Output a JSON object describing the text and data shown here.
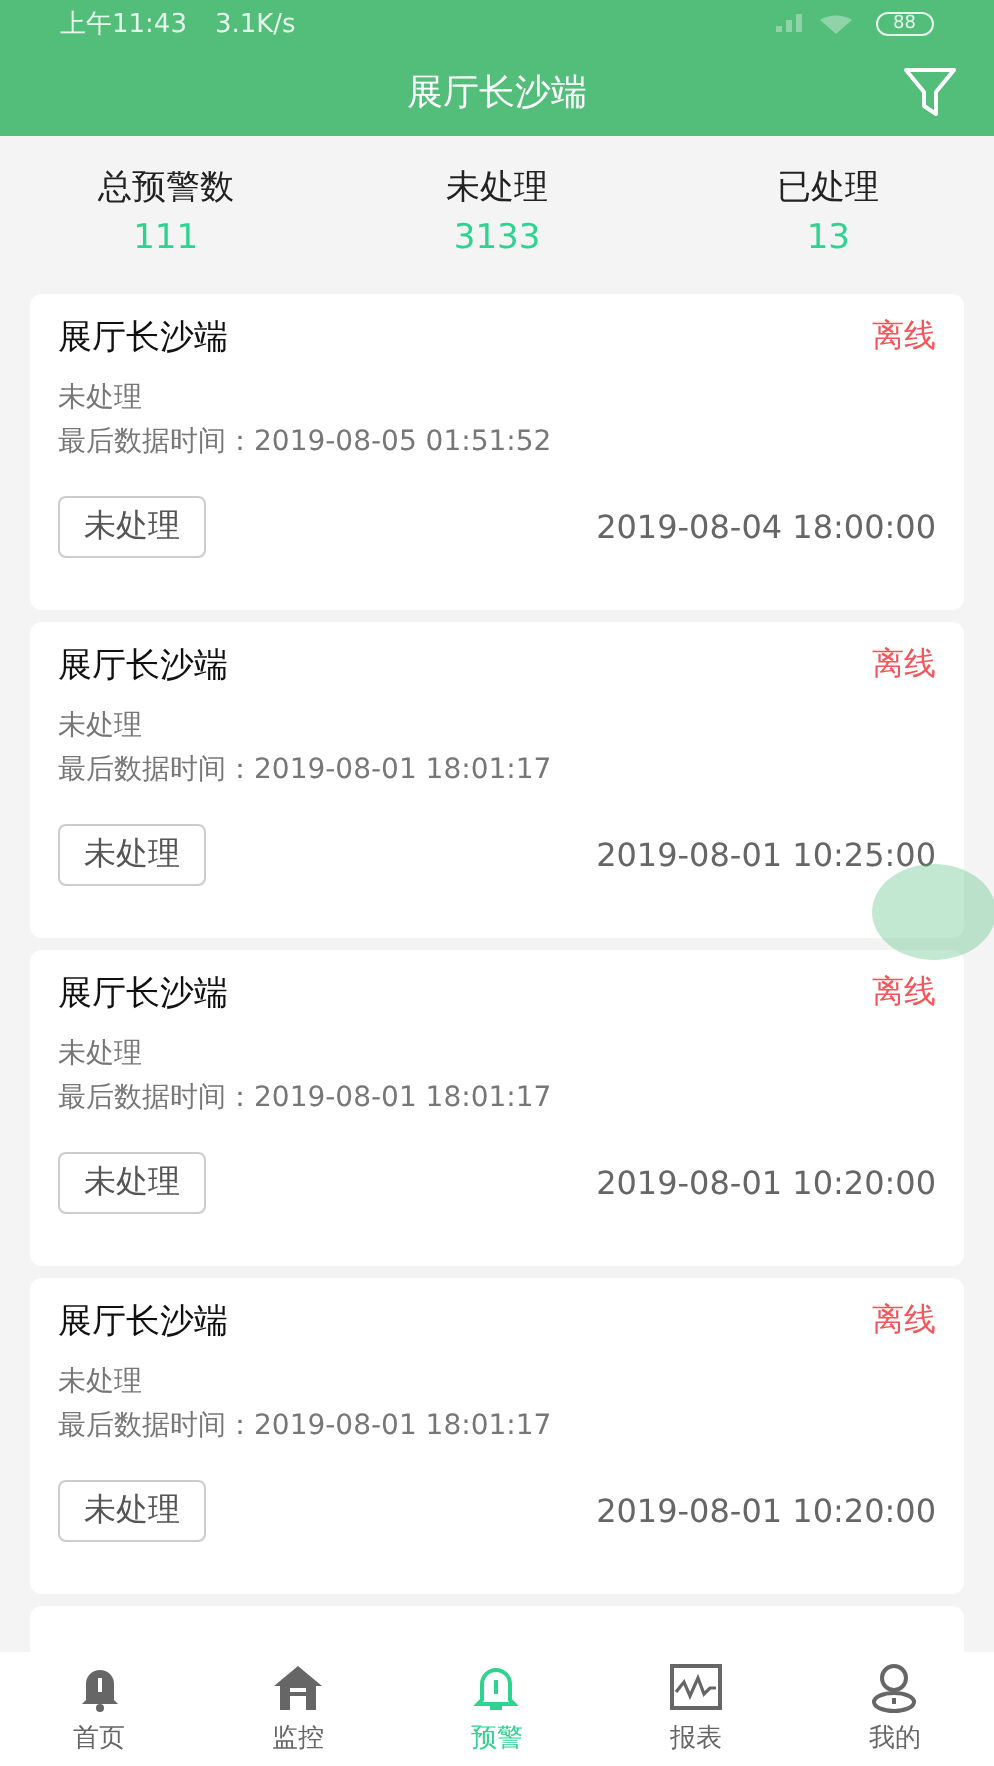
{
  "status_bar": {
    "time": "上午11:43",
    "speed": "3.1K/s",
    "battery": "88"
  },
  "header": {
    "title": "展厅长沙端"
  },
  "stats": [
    {
      "label": "总预警数",
      "value": "111"
    },
    {
      "label": "未处理",
      "value": "3133"
    },
    {
      "label": "已处理",
      "value": "13"
    }
  ],
  "alerts": [
    {
      "name": "展厅长沙端",
      "status": "离线",
      "state": "未处理",
      "last_data": "最后数据时间：2019-08-05 01:51:52",
      "button": "未处理",
      "time": "2019-08-04 18:00:00"
    },
    {
      "name": "展厅长沙端",
      "status": "离线",
      "state": "未处理",
      "last_data": "最后数据时间：2019-08-01 18:01:17",
      "button": "未处理",
      "time": "2019-08-01 10:25:00"
    },
    {
      "name": "展厅长沙端",
      "status": "离线",
      "state": "未处理",
      "last_data": "最后数据时间：2019-08-01 18:01:17",
      "button": "未处理",
      "time": "2019-08-01 10:20:00"
    },
    {
      "name": "展厅长沙端",
      "status": "离线",
      "state": "未处理",
      "last_data": "最后数据时间：2019-08-01 18:01:17",
      "button": "未处理",
      "time": "2019-08-01 10:20:00"
    }
  ],
  "nav": [
    {
      "label": "首页",
      "kind": "bell",
      "selected": false
    },
    {
      "label": "监控",
      "kind": "house",
      "selected": false
    },
    {
      "label": "预警",
      "kind": "alert",
      "selected": true
    },
    {
      "label": "报表",
      "kind": "chart",
      "selected": false
    },
    {
      "label": "我的",
      "kind": "user",
      "selected": false
    }
  ]
}
